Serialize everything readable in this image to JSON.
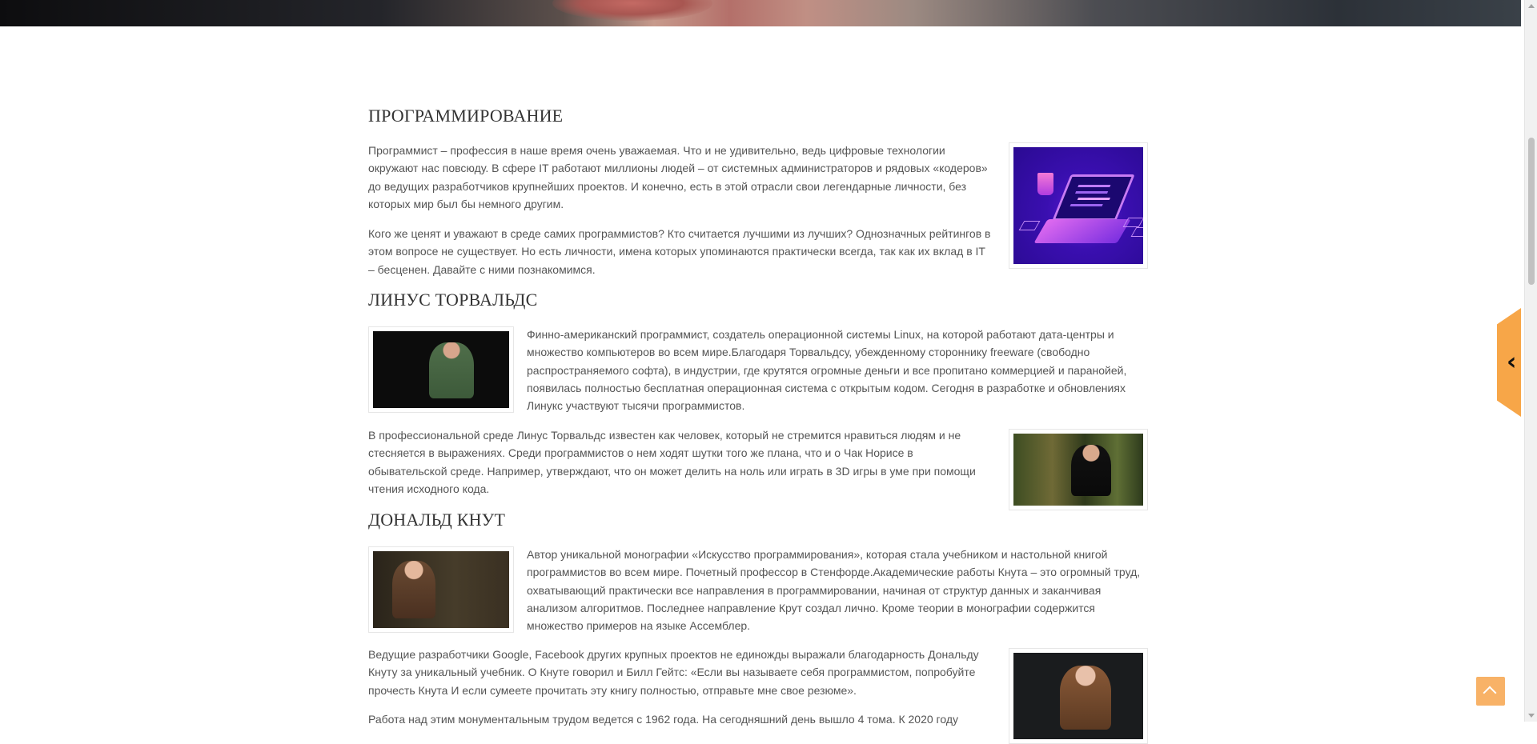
{
  "sections": [
    {
      "heading": "ПРОГРАММИРОВАНИЕ",
      "paragraphs": [
        "Программист – профессия в наше время очень уважаемая. Что и не удивительно, ведь цифровые технологии окружают нас повсюду. В сфере IT работают миллионы людей – от системных администраторов и рядовых «кодеров» до ведущих разработчиков крупнейших проектов. И конечно, есть в этой отрасли свои легендарные личности, без которых мир был бы немного другим.",
        "Кого же ценят и уважают в среде самих программистов? Кто считается лучшими из лучших? Однозначных рейтингов в этом вопросе не существует. Но есть личности, имена которых упоминаются практически всегда, так как их вклад в IT – бесценен. Давайте с ними познакомимся."
      ]
    },
    {
      "heading": "ЛИНУС ТОРВАЛЬДС",
      "paragraphs": [
        "Финно-американский программист, создатель операционной системы Linux, на которой работают дата-центры и множество компьютеров во всем мире.Благодаря Торвальдсу, убежденному стороннику freeware (свободно распространяемого софта), в индустрии, где крутятся огромные деньги и все пропитано коммерцией и паранойей, появилась полностью бесплатная операционная система с открытым кодом. Сегодня в разработке и обновлениях Линукс участвуют тысячи программистов.",
        "В профессиональной среде Линус Торвальдс известен как человек, который не стремится нравиться людям и не стесняется в выражениях. Среди программистов о нем ходят шутки того же плана, что и о Чак Норисе в обывательской среде. Например, утверждают, что он может делить на ноль или играть в 3D игры в уме при помощи чтения исходного кода."
      ]
    },
    {
      "heading": "ДОНАЛЬД КНУТ",
      "paragraphs": [
        "Автор уникальной монографии «Искусство программирования», которая стала учебником и настольной книгой программистов во всем мире. Почетный профессор в Стенфорде.Академические работы Кнута – это огромный труд, охватывающий практически все направления в программировании, начиная от структур данных и заканчивая анализом алгоритмов. Последнее направление Крут создал лично. Кроме теории в монографии содержится множество примеров на языке Ассемблер.",
        "Ведущие разработчики Google, Facebook других крупных проектов не единожды выражали благодарность Дональду Кнуту за уникальный учебник. О Кнуте говорил и Билл Гейтс: «Если вы называете себя программистом, попробуйте прочесть Кнута И если сумеете прочитать эту книгу полностью, отправьте мне свое резюме».",
        "Работа над этим монументальным трудом ведется с 1962 года. На сегодняшний день вышло 4 тома. К 2020 году"
      ]
    }
  ],
  "images": {
    "laptop": "laptop-illustration",
    "torvalds_stage": "torvalds-stage-photo",
    "torvalds_forest": "torvalds-forest-photo",
    "knuth_board": "knuth-blackboard-photo",
    "knuth_portrait": "knuth-portrait-photo"
  },
  "ui": {
    "side_tab_icon": "chevron-left-icon",
    "scroll_top_icon": "chevron-up-icon",
    "accent_color": "#f7a648"
  }
}
